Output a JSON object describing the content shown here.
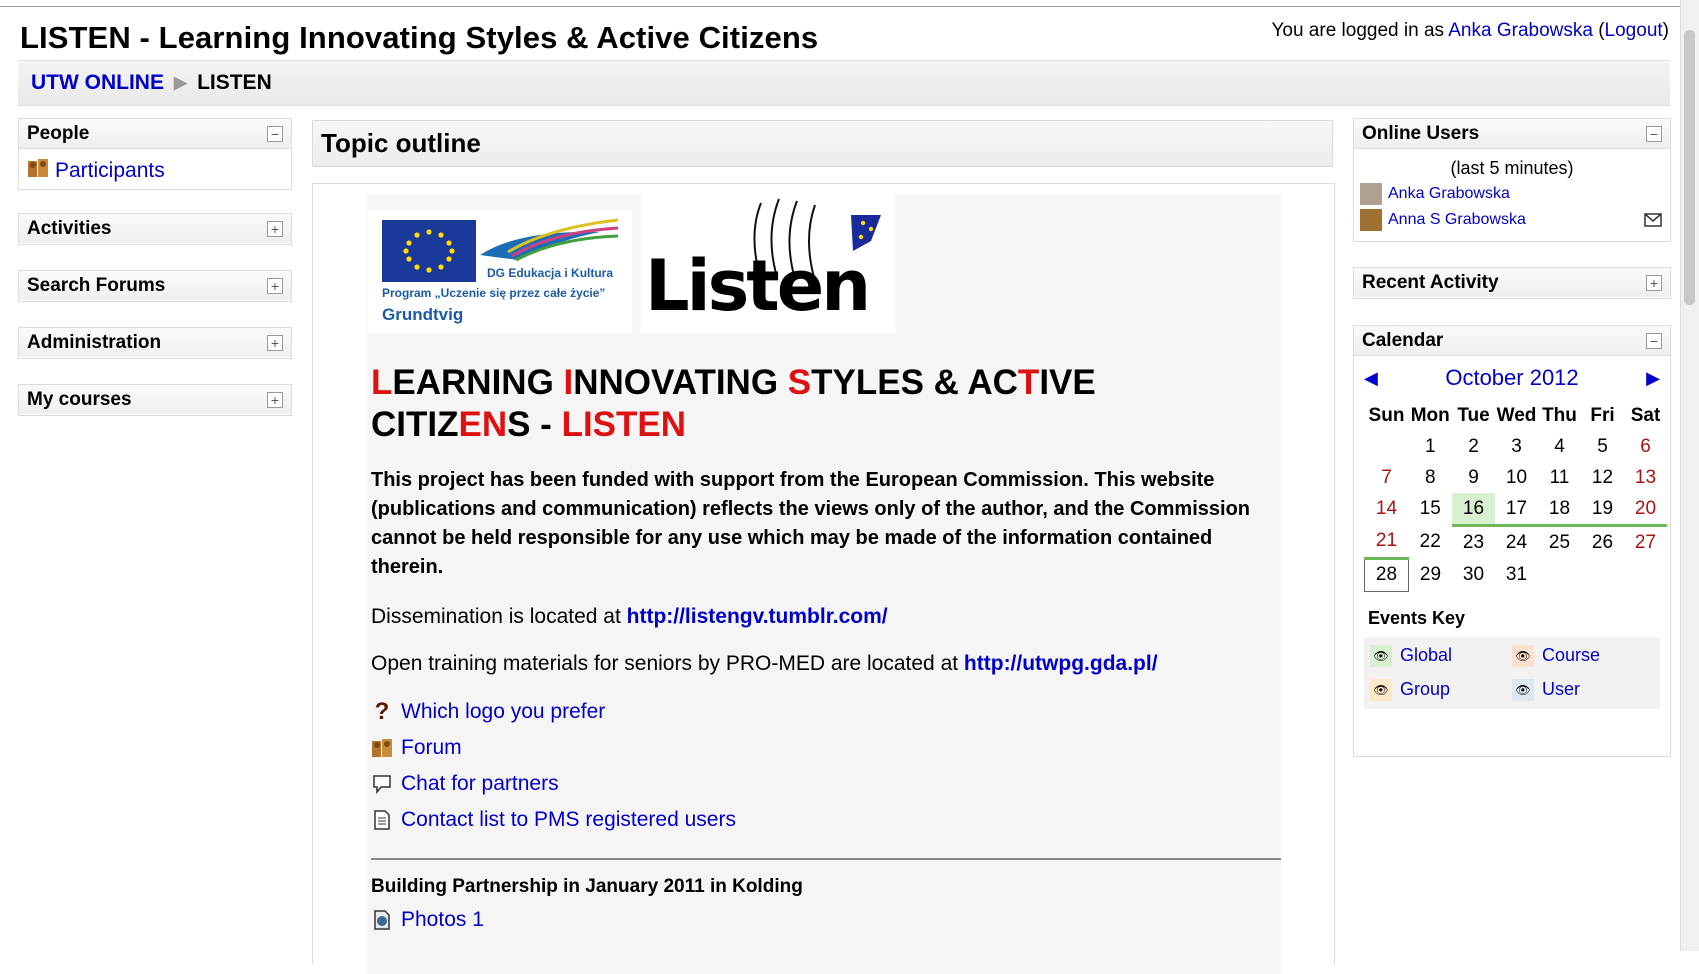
{
  "page_title": "LISTEN - Learning Innovating Styles & Active Citizens",
  "login": {
    "prefix": "You are logged in as ",
    "user": "Anka Grabowska",
    "open": " (",
    "logout": "Logout",
    "close": ")"
  },
  "breadcrumb": {
    "root": "UTW ONLINE",
    "separator": "▶",
    "current": "LISTEN"
  },
  "left_blocks": {
    "people": {
      "title": "People",
      "toggle": "−",
      "participants": "Participants"
    },
    "activities": {
      "title": "Activities",
      "toggle": "+"
    },
    "search_forums": {
      "title": "Search Forums",
      "toggle": "+"
    },
    "administration": {
      "title": "Administration",
      "toggle": "+"
    },
    "my_courses": {
      "title": "My courses",
      "toggle": "+"
    }
  },
  "main": {
    "header": "Topic outline",
    "logo_eu": {
      "line1": "DG Edukacja i Kultura",
      "line2": "Program „Uczenie się przez całe życie”",
      "line3": "Grundtvig"
    },
    "logo_listen": "Listen",
    "title_parts": [
      "L",
      "EARNING ",
      "I",
      "NNOVATING ",
      "S",
      "TYLES & AC",
      "T",
      "IVE",
      "CITIZ",
      "EN",
      "S - ",
      "LISTEN"
    ],
    "funding": "This project has been funded with support from the European Commission. This website (publications and communication) reflects the views only of the author, and the Commission cannot be held responsible for any use which may be made of the information contained therein.",
    "dissemination_text": "Dissemination is located at ",
    "dissemination_link": "http://listengv.tumblr.com/",
    "training_text": "Open training materials for seniors by PRO-MED are located at ",
    "training_link": "http://utwpg.gda.pl/",
    "resources": [
      "Which logo you prefer",
      "Forum",
      "Chat for partners",
      "Contact list to PMS registered users"
    ],
    "section_title": "Building Partnership in January 2011 in Kolding",
    "section_resource": "Photos 1"
  },
  "online_users": {
    "title": "Online Users",
    "toggle": "−",
    "subtitle": "(last 5 minutes)",
    "users": [
      "Anka Grabowska",
      "Anna S Grabowska"
    ]
  },
  "recent_activity": {
    "title": "Recent Activity",
    "toggle": "+"
  },
  "calendar": {
    "title": "Calendar",
    "toggle": "−",
    "month": "October 2012",
    "prev": "◀",
    "next": "▶",
    "days": [
      "Sun",
      "Mon",
      "Tue",
      "Wed",
      "Thu",
      "Fri",
      "Sat"
    ],
    "weeks": [
      [
        "",
        "1",
        "2",
        "3",
        "4",
        "5",
        "6"
      ],
      [
        "7",
        "8",
        "9",
        "10",
        "11",
        "12",
        "13"
      ],
      [
        "14",
        "15",
        "16",
        "17",
        "18",
        "19",
        "20"
      ],
      [
        "21",
        "22",
        "23",
        "24",
        "25",
        "26",
        "27"
      ],
      [
        "28",
        "29",
        "30",
        "31",
        "",
        "",
        ""
      ]
    ],
    "events_key_title": "Events Key",
    "events_key": [
      "Global",
      "Course",
      "Group",
      "User"
    ]
  },
  "colors": {
    "link": "#0000cc",
    "title_red": "#dd1111",
    "event_global": "#d8f0d0",
    "event_course": "#fde0d0",
    "event_group": "#fde8c8",
    "event_user": "#dde8ee"
  }
}
